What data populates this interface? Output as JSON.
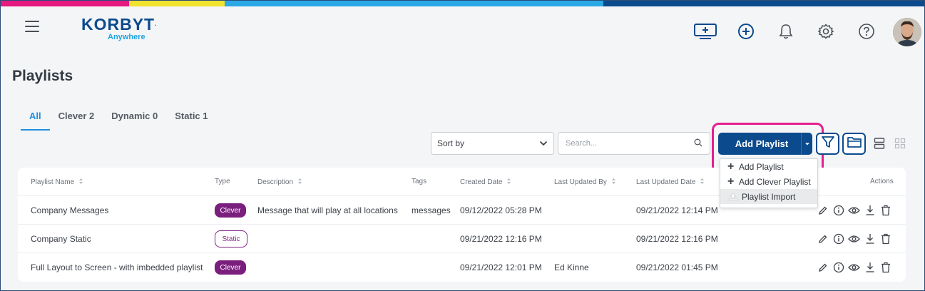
{
  "colors": {
    "stripe": [
      "#e6197f",
      "#f2e230",
      "#2ba9e6",
      "#0b4a8c"
    ],
    "brand": "#0b4a8c",
    "accent": "#1e8fe0",
    "badge": "#7b1f7f",
    "highlight": "#e61e8c"
  },
  "header": {
    "logo_text": "KORBYT",
    "logo_sub": "Anywhere",
    "icons": [
      "screen-add-icon",
      "plus-circle-icon",
      "bell-icon",
      "gear-icon",
      "help-icon"
    ]
  },
  "page": {
    "title": "Playlists"
  },
  "tabs": [
    {
      "label": "All",
      "active": true
    },
    {
      "label": "Clever 2",
      "active": false
    },
    {
      "label": "Dynamic 0",
      "active": false
    },
    {
      "label": "Static 1",
      "active": false
    }
  ],
  "toolbar": {
    "sort_label": "Sort by",
    "search_placeholder": "Search...",
    "add_button": "Add Playlist"
  },
  "dropdown": {
    "items": [
      {
        "label": "Add Playlist",
        "icon": "plus-icon"
      },
      {
        "label": "Add Clever Playlist",
        "icon": "plus-icon"
      },
      {
        "label": "Playlist Import",
        "icon": "upload-icon"
      }
    ]
  },
  "table": {
    "columns": {
      "name": "Playlist Name",
      "type": "Type",
      "description": "Description",
      "tags": "Tags",
      "created": "Created Date",
      "updated_by": "Last Updated By",
      "updated_date": "Last Updated Date",
      "actions": "Actions"
    },
    "rows": [
      {
        "name": "Company Messages",
        "type": "Clever",
        "description": "Message that will play at all locations",
        "tags": "messages",
        "created": "09/12/2022 05:28 PM",
        "updated_by": "",
        "updated_date": "09/21/2022 12:14 PM"
      },
      {
        "name": "Company Static",
        "type": "Static",
        "description": "",
        "tags": "",
        "created": "09/21/2022 12:16 PM",
        "updated_by": "",
        "updated_date": "09/21/2022 12:16 PM"
      },
      {
        "name": "Full Layout to Screen - with imbedded playlist",
        "type": "Clever",
        "description": "",
        "tags": "",
        "created": "09/21/2022 12:01 PM",
        "updated_by": "Ed Kinne",
        "updated_date": "09/21/2022 01:45 PM"
      }
    ]
  }
}
